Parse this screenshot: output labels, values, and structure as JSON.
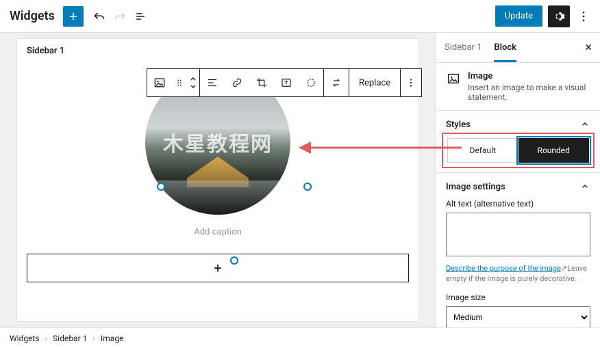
{
  "topbar": {
    "title": "Widgets",
    "update_label": "Update"
  },
  "canvas": {
    "sidebar_title": "Sidebar 1",
    "toolbar": {
      "replace_label": "Replace"
    },
    "caption_placeholder": "Add caption",
    "watermark": "木星教程网"
  },
  "inspector": {
    "tabs": {
      "sidebar": "Sidebar 1",
      "block": "Block"
    },
    "block": {
      "title": "Image",
      "desc": "Insert an image to make a visual statement."
    },
    "styles": {
      "heading": "Styles",
      "default": "Default",
      "rounded": "Rounded"
    },
    "image_settings": {
      "heading": "Image settings",
      "alt_label": "Alt text (alternative text)",
      "help_link": "Describe the purpose of the image",
      "help_tail": "Leave empty if the image is purely decorative.",
      "size_label": "Image size",
      "size_value": "Medium"
    }
  },
  "breadcrumb": {
    "a": "Widgets",
    "b": "Sidebar 1",
    "c": "Image"
  }
}
